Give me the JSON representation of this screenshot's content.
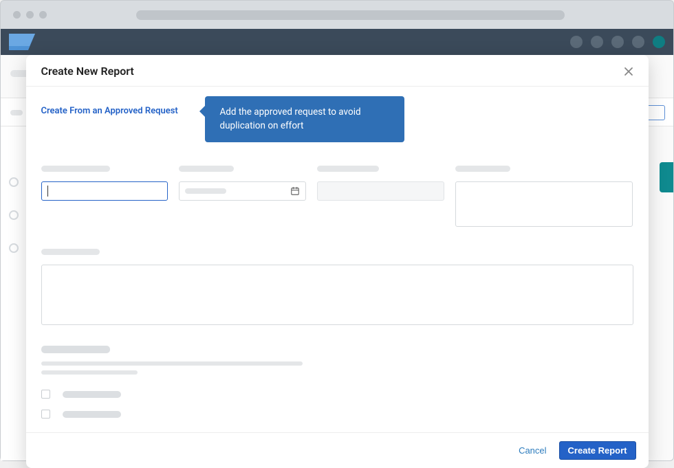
{
  "modal": {
    "title": "Create New Report",
    "create_from_link": "Create From an Approved Request",
    "tooltip_text": "Add the approved request to avoid duplication on effort",
    "cancel_label": "Cancel",
    "create_label": "Create Report"
  }
}
